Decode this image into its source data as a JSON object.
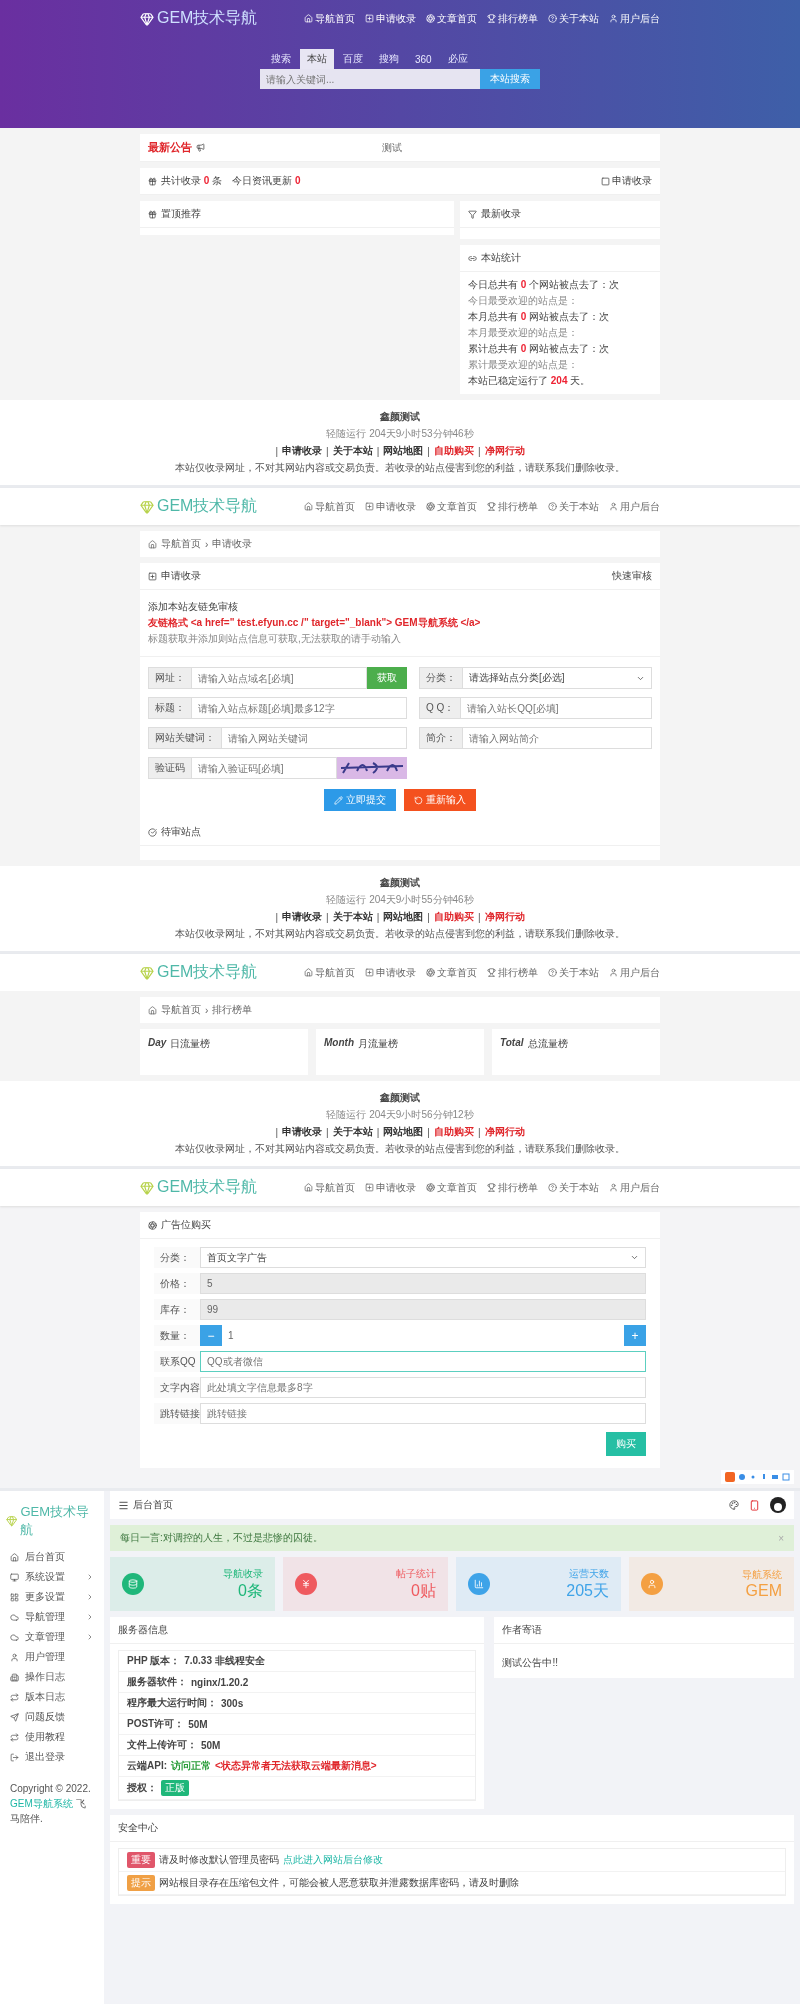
{
  "home": {
    "logo": "GEM技术导航",
    "nav": [
      "导航首页",
      "申请收录",
      "文章首页",
      "排行榜单",
      "关于本站",
      "用户后台"
    ],
    "search_tabs": [
      {
        "label": "搜索",
        "selected": false
      },
      {
        "label": "本站",
        "selected": true
      },
      {
        "label": "百度",
        "selected": false
      },
      {
        "label": "搜狗",
        "selected": false
      },
      {
        "label": "360",
        "selected": false
      },
      {
        "label": "必应",
        "selected": false
      }
    ],
    "search": {
      "placeholder": "请输入关键词...",
      "button": "本站搜索"
    },
    "notice": {
      "title": "最新公告",
      "text": "测试"
    },
    "stats": {
      "text": "共计收录 **0** 条　今日资讯更新 **0**",
      "link": "申请收录"
    },
    "featured": {
      "title": "置顶推荐"
    },
    "latest": {
      "title": "最新收录"
    },
    "site_stats": {
      "title": "本站统计",
      "lines": [
        "今日总共有 **0** 个网站被点去了：次",
        "今日最受欢迎的站点是：",
        "本月总共有 **0** 网站被点去了：次",
        "本月最受欢迎的站点是：",
        "累计总共有 **0** 网站被点去了：次",
        "累计最受欢迎的站点是：",
        "本站已稳定运行了 **204** 天。"
      ]
    },
    "footer": {
      "title": "鑫颜测试",
      "uptime": "轻随运行 204天9小时53分钟46秒",
      "separator": "|",
      "links": [
        {
          "label": "申请收录",
          "highlight": false
        },
        {
          "label": "关于本站",
          "highlight": false
        },
        {
          "label": "网站地图",
          "highlight": false
        },
        {
          "label": "自助购买",
          "highlight": true
        },
        {
          "label": "净网行动",
          "highlight": true
        }
      ],
      "note": "本站仅收录网址，不对其网站内容或交易负责。若收录的站点侵害到您的利益，请联系我们删除收录。"
    }
  },
  "submit": {
    "logo": "GEM技术导航",
    "nav": [
      "导航首页",
      "申请收录",
      "文章首页",
      "排行榜单",
      "关于本站",
      "用户后台"
    ],
    "breadcrumb": {
      "items": [
        "导航首页",
        "申请收录"
      ],
      "separator": "›"
    },
    "panel": {
      "title": "申请收录",
      "action": "快速审核"
    },
    "intro": [
      "添加本站友链免审核",
      "友链格式 <a href=\" test.efyun.cc /\" target=\"_blank\"> GEM导航系统 </a>",
      "标题获取并添加则站点信息可获取,无法获取的请手动输入"
    ],
    "fields": [
      {
        "kind": "fetch",
        "label": "网址：",
        "placeholder": "请输入站点域名[必填]",
        "button": "获取"
      },
      {
        "kind": "select",
        "label": "分类：",
        "value": "请选择站点分类[必选]"
      },
      {
        "kind": "input",
        "label": "标题：",
        "placeholder": "请输入站点标题[必填]最多12字"
      },
      {
        "kind": "input",
        "label": "Q Q：",
        "placeholder": "请输入站长QQ[必填]"
      },
      {
        "kind": "input",
        "label": "网站关键词：",
        "placeholder": "请输入网站关键词"
      },
      {
        "kind": "input",
        "label": "简介：",
        "placeholder": "请输入网站简介"
      },
      {
        "kind": "captcha",
        "label": "验证码",
        "placeholder": "请输入验证码[必填]"
      }
    ],
    "submit_button": "立即提交",
    "reset_button": "重新输入",
    "pending": "待审站点",
    "footer": {
      "title": "鑫颜测试",
      "uptime": "轻随运行 204天9小时55分钟46秒",
      "separator": "|",
      "links": [
        {
          "label": "申请收录",
          "highlight": false
        },
        {
          "label": "关于本站",
          "highlight": false
        },
        {
          "label": "网站地图",
          "highlight": false
        },
        {
          "label": "自助购买",
          "highlight": true
        },
        {
          "label": "净网行动",
          "highlight": true
        }
      ],
      "note": "本站仅收录网址，不对其网站内容或交易负责。若收录的站点侵害到您的利益，请联系我们删除收录。"
    }
  },
  "ranking": {
    "logo": "GEM技术导航",
    "nav": [
      "导航首页",
      "申请收录",
      "文章首页",
      "排行榜单",
      "关于本站",
      "用户后台"
    ],
    "breadcrumb": {
      "items": [
        "导航首页",
        "排行榜单"
      ],
      "separator": "›"
    },
    "boards": [
      {
        "tag": "Day",
        "title": "日流量榜"
      },
      {
        "tag": "Month",
        "title": "月流量榜"
      },
      {
        "tag": "Total",
        "title": "总流量榜"
      }
    ],
    "footer": {
      "title": "鑫颜测试",
      "uptime": "轻随运行 204天9小时56分钟12秒",
      "separator": "|",
      "links": [
        {
          "label": "申请收录",
          "highlight": false
        },
        {
          "label": "关于本站",
          "highlight": false
        },
        {
          "label": "网站地图",
          "highlight": false
        },
        {
          "label": "自助购买",
          "highlight": true
        },
        {
          "label": "净网行动",
          "highlight": true
        }
      ],
      "note": "本站仅收录网址，不对其网站内容或交易负责。若收录的站点侵害到您的利益，请联系我们删除收录。"
    }
  },
  "ad_purchase": {
    "logo": "GEM技术导航",
    "nav": [
      "导航首页",
      "申请收录",
      "文章首页",
      "排行榜单",
      "关于本站",
      "用户后台"
    ],
    "title": "广告位购买",
    "rows": [
      {
        "kind": "select",
        "label": "分类：",
        "value": "首页文字广告"
      },
      {
        "kind": "readonly",
        "label": "价格：",
        "value": "5"
      },
      {
        "kind": "readonly",
        "label": "库存：",
        "value": "99"
      },
      {
        "kind": "stepper",
        "label": "数量：",
        "value": "1",
        "minus": "−",
        "plus": "+"
      },
      {
        "kind": "input",
        "label": "联系QQ",
        "placeholder": "QQ或者微信",
        "focused": true
      },
      {
        "kind": "input",
        "label": "文字内容",
        "placeholder": "此处填文字信息最多8字",
        "focused": false
      },
      {
        "kind": "input",
        "label": "跳转链接",
        "placeholder": "跳转链接",
        "focused": false
      }
    ],
    "buy_button": "购买"
  },
  "admin": {
    "logo": "GEM技术导航",
    "page_title": "后台首页",
    "sidebar": [
      {
        "label": "后台首页",
        "expandable": false
      },
      {
        "label": "系统设置",
        "expandable": true
      },
      {
        "label": "更多设置",
        "expandable": true
      },
      {
        "label": "导航管理",
        "expandable": true
      },
      {
        "label": "文章管理",
        "expandable": true
      },
      {
        "label": "用户管理",
        "expandable": false
      },
      {
        "label": "操作日志",
        "expandable": false
      },
      {
        "label": "版本日志",
        "expandable": false
      },
      {
        "label": "问题反馈",
        "expandable": false
      },
      {
        "label": "使用教程",
        "expandable": false
      },
      {
        "label": "退出登录",
        "expandable": false
      }
    ],
    "copyright": {
      "text": "Copyright © 2022.",
      "link": "GEM导航系统",
      "suffix": "飞马陪伴."
    },
    "alert": {
      "text": "每日一言:对调控的人生，不过是悲惨的囚徒。",
      "close": "×"
    },
    "cards": [
      {
        "label": "导航收录",
        "value": "0条",
        "color": "#1fb77a"
      },
      {
        "label": "帖子统计",
        "value": "0贴",
        "color": "#ef5a5f"
      },
      {
        "label": "运营天数",
        "value": "205天",
        "color": "#3ea3e8"
      },
      {
        "label": "导航系统",
        "value": "GEM",
        "color": "#f4a042"
      }
    ],
    "server": {
      "title": "服务器信息",
      "rows": [
        {
          "kind": "plain",
          "label": "PHP 版本：",
          "value": "7.0.33 非线程安全"
        },
        {
          "kind": "plain",
          "label": "服务器软件：",
          "value": "nginx/1.20.2"
        },
        {
          "kind": "plain",
          "label": "程序最大运行时间：",
          "value": "300s"
        },
        {
          "kind": "plain",
          "label": "POST许可：",
          "value": "50M"
        },
        {
          "kind": "plain",
          "label": "文件上传许可：",
          "value": "50M"
        },
        {
          "kind": "status",
          "label": "云端API:",
          "value": "访问正常",
          "note": "<状态异常者无法获取云端最新消息>"
        },
        {
          "kind": "badge",
          "label": "授权：",
          "value": "正版"
        }
      ]
    },
    "author": {
      "title": "作者寄语",
      "text": "测试公告中!!"
    },
    "security": {
      "title": "安全中心",
      "rows": [
        {
          "badge": "重要",
          "color": "#e0566a",
          "text": "请及时修改默认管理员密码",
          "link": "点此进入网站后台修改"
        },
        {
          "badge": "提示",
          "color": "#f0a045",
          "text": "网站根目录存在压缩包文件，可能会被人恶意获取并泄露数据库密码，请及时删除"
        }
      ]
    }
  }
}
